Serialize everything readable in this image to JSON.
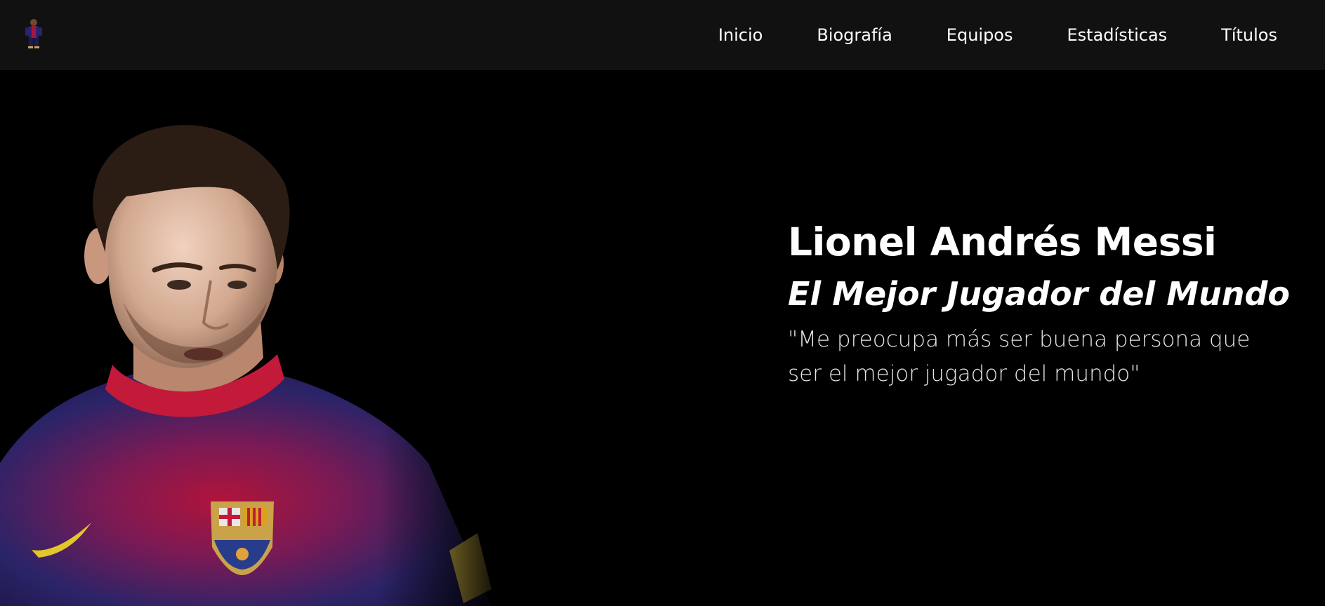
{
  "nav": {
    "logo_icon": "player-thumbnail-icon",
    "links": [
      "Inicio",
      "Biografía",
      "Equipos",
      "Estadísticas",
      "Títulos"
    ]
  },
  "hero": {
    "title": "Lionel Andrés Messi",
    "subtitle": "El Mejor Jugador del Mundo",
    "quote": "\"Me preocupa más ser buena persona que ser el mejor jugador del mundo\"",
    "image_icon": "player-portrait-image"
  },
  "colors": {
    "navbar_bg": "#111111",
    "hero_bg": "#000000",
    "text": "#ffffff",
    "jersey_blue": "#26205e",
    "jersey_red": "#b0143a"
  }
}
